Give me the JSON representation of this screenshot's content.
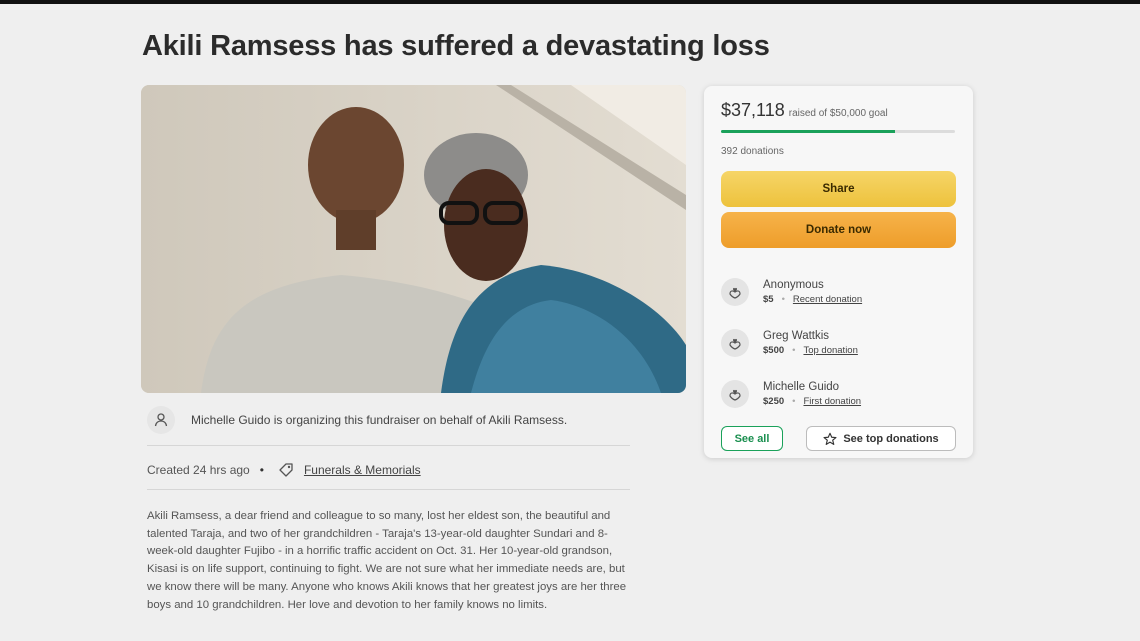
{
  "page": {
    "title": "Akili Ramsess has suffered a devastating loss"
  },
  "organizer": {
    "text": "Michelle Guido is organizing this fundraiser on behalf of Akili Ramsess."
  },
  "meta": {
    "created": "Created 24 hrs ago",
    "bullet": "•",
    "category": "Funerals & Memorials"
  },
  "story": {
    "text": "Akili Ramsess, a dear friend and colleague to so many, lost her eldest son, the beautiful and talented Taraja, and two of her grandchildren - Taraja's 13-year-old daughter Sundari and 8-week-old daughter Fujibo - in a horrific traffic accident on Oct. 31. Her 10-year-old grandson, Kisasi is on life support, continuing to fight. We are not sure what her immediate needs are, but we know there will be many. Anyone who knows Akili knows that her greatest joys are her three boys and 10 grandchildren. Her love and devotion to her family knows no limits."
  },
  "campaign": {
    "raised": "$37,118",
    "goal_text": "raised of $50,000 goal",
    "progress_fraction": 0.742,
    "donation_count": "392 donations",
    "share_label": "Share",
    "donate_label": "Donate now",
    "accent_color": "#1aa15a"
  },
  "donations": [
    {
      "name": "Anonymous",
      "amount": "$5",
      "label": "Recent donation",
      "icon": "donation-hands-icon"
    },
    {
      "name": "Greg Wattkis",
      "amount": "$500",
      "label": "Top donation",
      "icon": "donation-hands-icon"
    },
    {
      "name": "Michelle Guido",
      "amount": "$250",
      "label": "First donation",
      "icon": "donation-hands-icon"
    }
  ],
  "donation_actions": {
    "see_all": "See all",
    "see_top": "See top donations"
  }
}
